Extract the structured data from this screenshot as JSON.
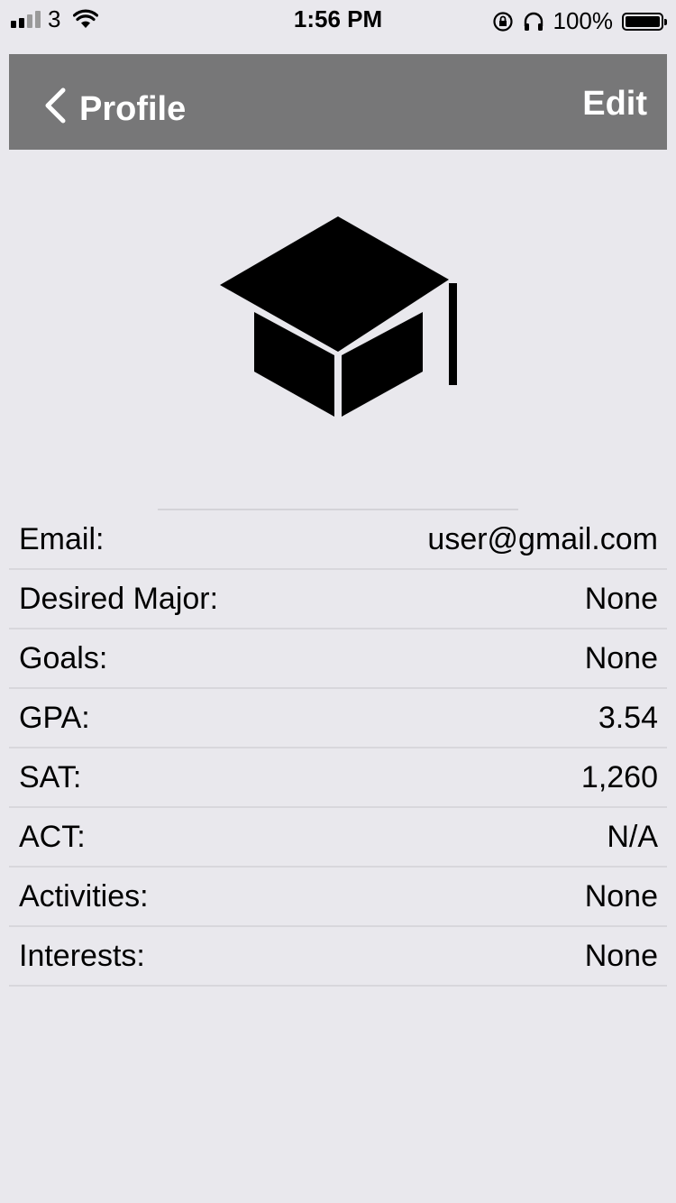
{
  "status_bar": {
    "carrier": "3",
    "time": "1:56 PM",
    "battery_percent": "100%",
    "battery_level": 1.0,
    "signal_bars_filled": 2,
    "signal_bars_total": 4,
    "icons": [
      "signal-icon",
      "wifi-icon",
      "rotation-lock-icon",
      "headphones-icon",
      "battery-icon"
    ]
  },
  "navbar": {
    "back_label": "Profile",
    "edit_label": "Edit",
    "background": "#777778",
    "text_color": "#ffffff"
  },
  "avatar": {
    "icon": "graduation-cap-icon"
  },
  "profile": {
    "rows": [
      {
        "label": "Email:",
        "value": "user@gmail.com"
      },
      {
        "label": "Desired Major:",
        "value": "None"
      },
      {
        "label": "Goals:",
        "value": "None"
      },
      {
        "label": "GPA:",
        "value": "3.54"
      },
      {
        "label": "SAT:",
        "value": "1,260"
      },
      {
        "label": "ACT:",
        "value": "N/A"
      },
      {
        "label": "Activities:",
        "value": "None"
      },
      {
        "label": "Interests:",
        "value": "None"
      }
    ]
  },
  "colors": {
    "background": "#e9e8ed",
    "divider": "#d8d7dc"
  }
}
